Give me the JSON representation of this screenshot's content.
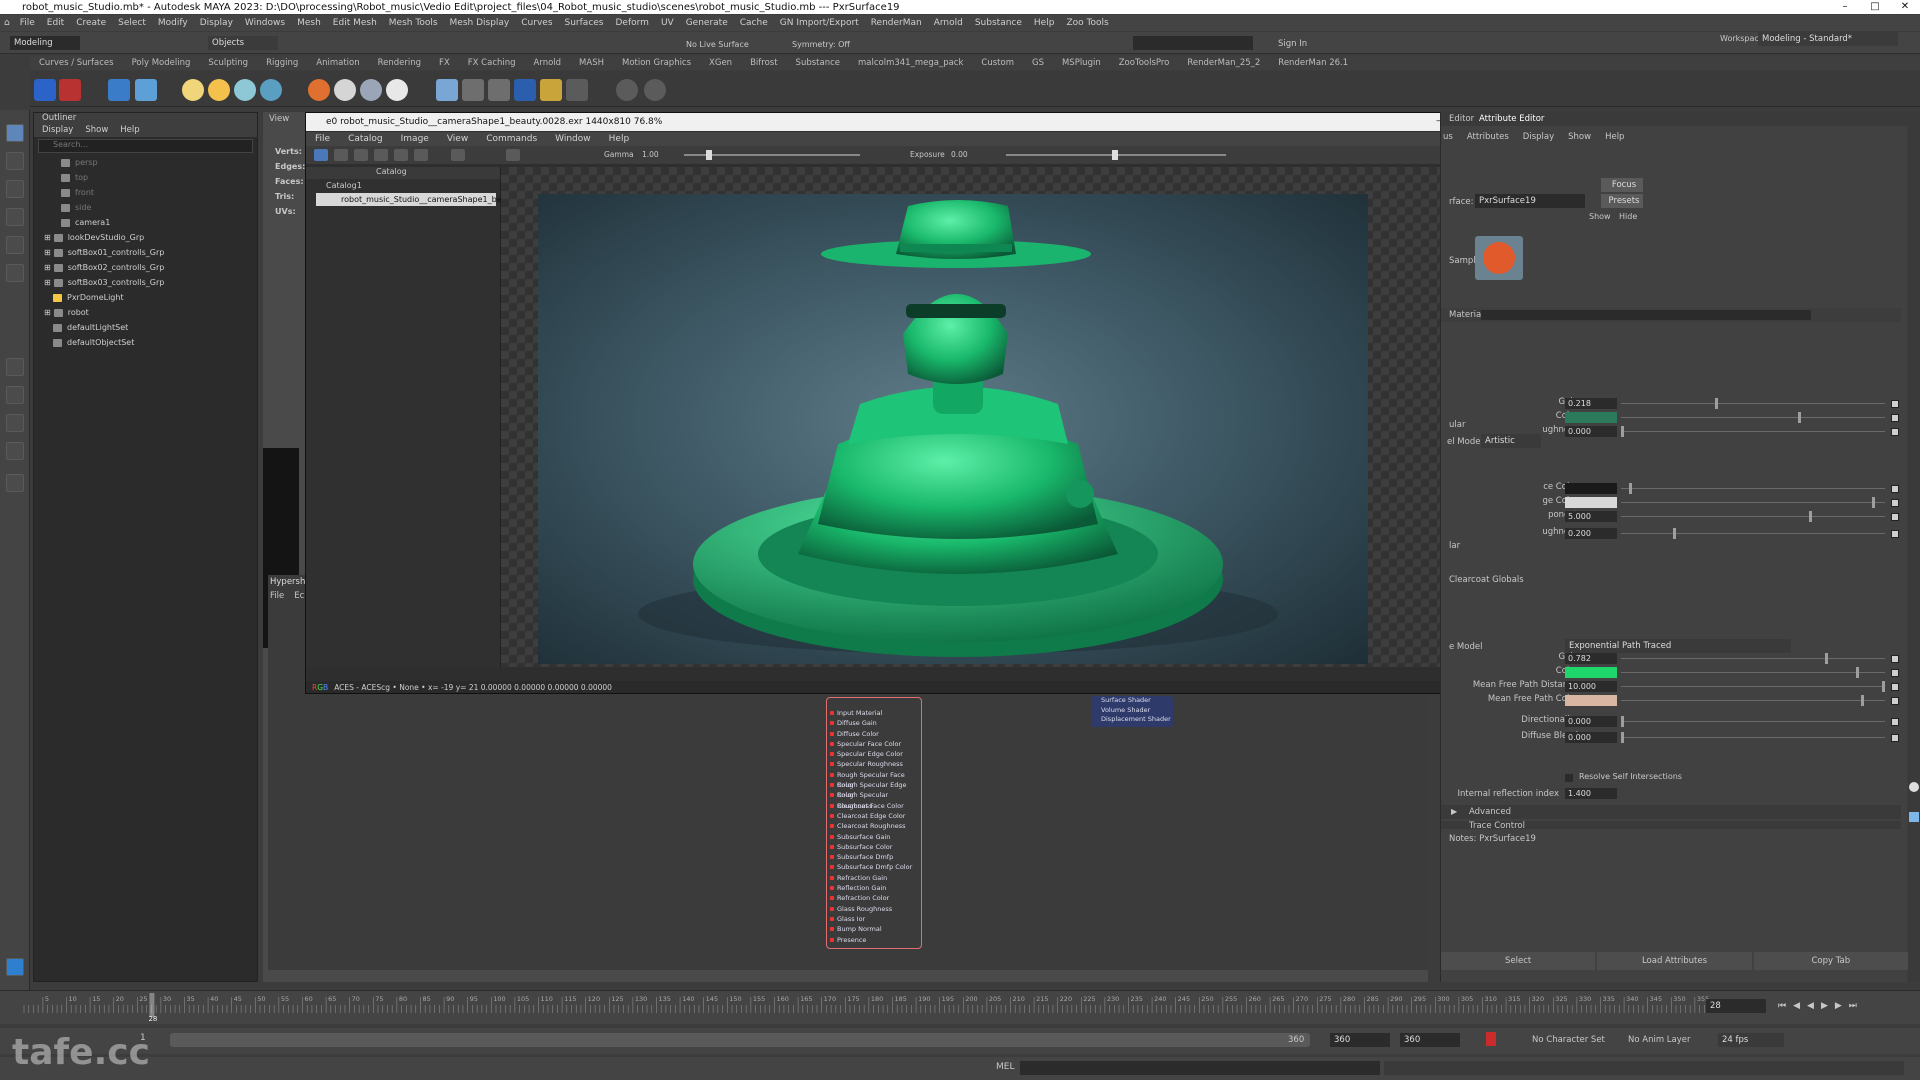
{
  "window": {
    "title": "robot_music_Studio.mb* - Autodesk MAYA 2023: D:\\DO\\processing\\Robot_music\\Vedio Edit\\project_files\\04_Robot_music_studio\\scenes\\robot_music_Studio.mb  ---  PxrSurface19"
  },
  "menubar": [
    "File",
    "Edit",
    "Create",
    "Select",
    "Modify",
    "Display",
    "Windows",
    "Mesh",
    "Edit Mesh",
    "Mesh Tools",
    "Mesh Display",
    "Curves",
    "Surfaces",
    "Deform",
    "UV",
    "Generate",
    "Cache",
    "GN Import/Export",
    "RenderMan",
    "Arnold",
    "Substance",
    "Help",
    "Zoo Tools"
  ],
  "statusline": {
    "mode": "Modeling",
    "objects": "Objects",
    "live_surface": "No Live Surface",
    "symmetry": "Symmetry: Off",
    "sign_in": "Sign In",
    "workspace_label": "Workspace:",
    "workspace": "Modeling - Standard*"
  },
  "shelf_tabs": [
    "Curves / Surfaces",
    "Poly Modeling",
    "Sculpting",
    "Rigging",
    "Animation",
    "Rendering",
    "FX",
    "FX Caching",
    "Arnold",
    "MASH",
    "Motion Graphics",
    "XGen",
    "Bifrost",
    "Substance",
    "malcolm341_mega_pack",
    "Custom",
    "GS",
    "MSPlugin",
    "ZooToolsPro",
    "RenderMan_25_2",
    "RenderMan 26.1"
  ],
  "outliner": {
    "title": "Outliner",
    "menu": [
      "Display",
      "Show",
      "Help"
    ],
    "search_placeholder": "Search...",
    "items": [
      "persp",
      "top",
      "front",
      "side",
      "camera1",
      "lookDevStudio_Grp",
      "softBox01_controlls_Grp",
      "softBox02_controlls_Grp",
      "softBox03_controlls_Grp",
      "PxrDomeLight",
      "robot",
      "defaultLightSet",
      "defaultObjectSet"
    ]
  },
  "viewport": {
    "panel_menu": "View",
    "stats": [
      "Verts:",
      "Edges:",
      "Faces:",
      "Tris:",
      "UVs:"
    ],
    "hypershade_title": "Hypersh",
    "hypershade_menu": [
      "File",
      "Ec"
    ]
  },
  "render_view": {
    "title": "e0 robot_music_Studio__cameraShape1_beauty.0028.exr 1440x810 76.8%",
    "menu": [
      "File",
      "Catalog",
      "Image",
      "View",
      "Commands",
      "Window",
      "Help"
    ],
    "gamma_label": "Gamma",
    "gamma_value": "1.00",
    "exposure_label": "Exposure",
    "exposure_value": "0.00",
    "catalog_header": "Catalog",
    "catalog_root": "Catalog1",
    "catalog_item": "robot_music_Studio__cameraShape1_beauty",
    "status": "ACES - ACEScg •   None •   x= -19  y= 21   0.00000 0.00000 0.00000 0.00000"
  },
  "node": {
    "attrs": [
      "Input Material",
      "Diffuse Gain",
      "Diffuse Color",
      "Specular Face Color",
      "Specular Edge Color",
      "Specular Roughness",
      "Rough Specular Face Color",
      "Rough Specular Edge Color",
      "Rough Specular Roughness",
      "Clearcoat Face Color",
      "Clearcoat Edge Color",
      "Clearcoat Roughness",
      "Subsurface Gain",
      "Subsurface Color",
      "Subsurface Dmfp",
      "Subsurface Dmfp Color",
      "Refraction Gain",
      "Reflection Gain",
      "Refraction Color",
      "Glass Roughness",
      "Glass Ior",
      "Bump Normal",
      "Presence"
    ],
    "outputs": [
      "Surface Shader",
      "Volume Shader",
      "Displacement Shader"
    ]
  },
  "attribute_editor": {
    "tabs": [
      "Editor",
      "Attribute Editor"
    ],
    "menu": [
      "us",
      "Attributes",
      "Display",
      "Show",
      "Help"
    ],
    "surface_label": "rface:",
    "surface_name": "PxrSurface19",
    "focus": "Focus",
    "presets": "Presets",
    "show": "Show",
    "hide": "Hide",
    "sample_label": "Sample",
    "material_label": "Material",
    "rows": [
      {
        "label": "Gain",
        "value": "0.218",
        "pos": 0.36
      },
      {
        "label": "Color",
        "value": "",
        "pos": 0.68
      },
      {
        "label": "ughness",
        "value": "0.000",
        "pos": 0.0
      }
    ],
    "section_ular": "ular",
    "model_mode_label": "el Mode",
    "model_mode": "Artistic",
    "spec_rows": [
      {
        "label": "ce Color",
        "value": "",
        "pos": 0.03
      },
      {
        "label": "ge Color",
        "value": "",
        "pos": 0.96
      },
      {
        "label": "ponent",
        "value": "5.000",
        "pos": 0.72
      },
      {
        "label": "ughness",
        "value": "0.200",
        "pos": 0.2
      }
    ],
    "section_lar": "lar",
    "clearcoat": "Clearcoat Globals",
    "sss_model_label": "e Model",
    "sss_model": "Exponential Path Traced",
    "sss_rows": [
      {
        "label": "Gain",
        "value": "0.782",
        "pos": 0.78
      },
      {
        "label": "Color",
        "value": "",
        "pos": 0.9
      },
      {
        "label": "Mean Free Path Distance",
        "value": "10.000",
        "pos": 1.0
      },
      {
        "label": "Mean Free Path Color",
        "value": "",
        "pos": 0.92
      },
      {
        "label": "Directionality",
        "value": "0.000",
        "pos": 0.0
      },
      {
        "label": "Diffuse Blend",
        "value": "0.000",
        "pos": 0.0
      }
    ],
    "resolve": "Resolve Self Intersections",
    "ior_label": "Internal reflection index",
    "ior_value": "1.400",
    "advanced": "Advanced",
    "trace": "Trace Control",
    "notes": "Notes:  PxrSurface19",
    "bottom_buttons": [
      "Select",
      "Load Attributes",
      "Copy Tab"
    ],
    "colors": {
      "diffuse": "#2b7a5c",
      "specface": "#1a1a1a",
      "specedge": "#d8d8d8",
      "sss": "#1fd66a",
      "mfp": "#d9b5a4"
    }
  },
  "timeline": {
    "ticks": [
      "5",
      "10",
      "15",
      "20",
      "25",
      "30",
      "35",
      "40",
      "45",
      "50",
      "55",
      "60",
      "65",
      "70",
      "75",
      "80",
      "85",
      "90",
      "95",
      "100",
      "105",
      "110",
      "115",
      "120",
      "125",
      "130",
      "135",
      "140",
      "145",
      "150",
      "155",
      "160",
      "165",
      "170",
      "175",
      "180",
      "185",
      "190",
      "195",
      "200",
      "205",
      "210",
      "215",
      "220",
      "225",
      "230",
      "235",
      "240",
      "245",
      "250",
      "255",
      "260",
      "265",
      "270",
      "275",
      "280",
      "285",
      "290",
      "295",
      "300",
      "305",
      "310",
      "315",
      "320",
      "325",
      "330",
      "335",
      "340",
      "345",
      "350",
      "355"
    ],
    "current_frame": "28",
    "current_frame_field": "28",
    "range_start": "1",
    "range_end": "360",
    "range_fields": [
      "360",
      "360",
      "360"
    ],
    "character_set": "No Character Set",
    "anim_layer": "No Anim Layer",
    "fps": "24 fps"
  },
  "cmdline": {
    "label": "MEL"
  },
  "watermark": "tafe.cc"
}
